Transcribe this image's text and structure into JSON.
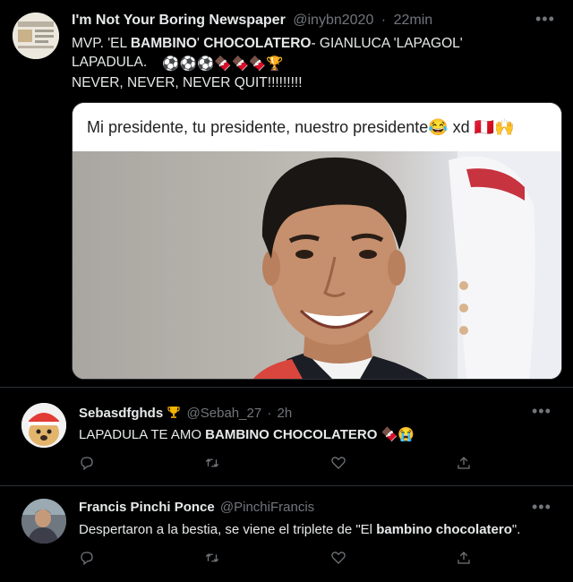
{
  "main_tweet": {
    "display_name": "I'm Not Your Boring Newspaper",
    "handle": "@inybn2020",
    "separator": "·",
    "time": "22min",
    "line1_prefix": "MVP.  'EL ",
    "line1_bold1": "BAMBINO",
    "line1_mid": "' ",
    "line1_bold2": "CHOCOLATERO",
    "line1_suffix": "- GIANLUCA 'LAPAGOL'",
    "line2": "LAPADULA.",
    "line2_emoji": "⚽⚽⚽🍫🍫🍫🏆",
    "line3": "NEVER, NEVER, NEVER QUIT!!!!!!!!!",
    "media_caption": "Mi presidente, tu presidente, nuestro presidente",
    "media_caption_suffix": "😂 xd 🇵🇪🙌"
  },
  "replies": [
    {
      "display_name": "Sebasdfghds",
      "handle": "@Sebah_27",
      "separator": "·",
      "time": "2h",
      "text_prefix": "LAPADULA TE AMO ",
      "text_bold": "BAMBINO CHOCOLATERO",
      "text_suffix": " 🍫😭",
      "text_end": ""
    },
    {
      "display_name": "Francis Pinchi Ponce",
      "handle": "@PinchiFrancis",
      "separator": "",
      "time": "",
      "text_prefix": "Despertaron a la bestia, se viene el triplete de \"El ",
      "text_bold": "bambino chocolatero",
      "text_suffix": "\".",
      "text_end": ""
    }
  ],
  "icons": {
    "more": "more-options-icon",
    "reply": "reply-icon",
    "retweet": "retweet-icon",
    "like": "like-icon",
    "share": "share-icon",
    "badge": "trophy-icon"
  },
  "colors": {
    "background": "#000000",
    "text": "#e7e9ea",
    "muted": "#71767b",
    "divider": "#2f3336"
  }
}
